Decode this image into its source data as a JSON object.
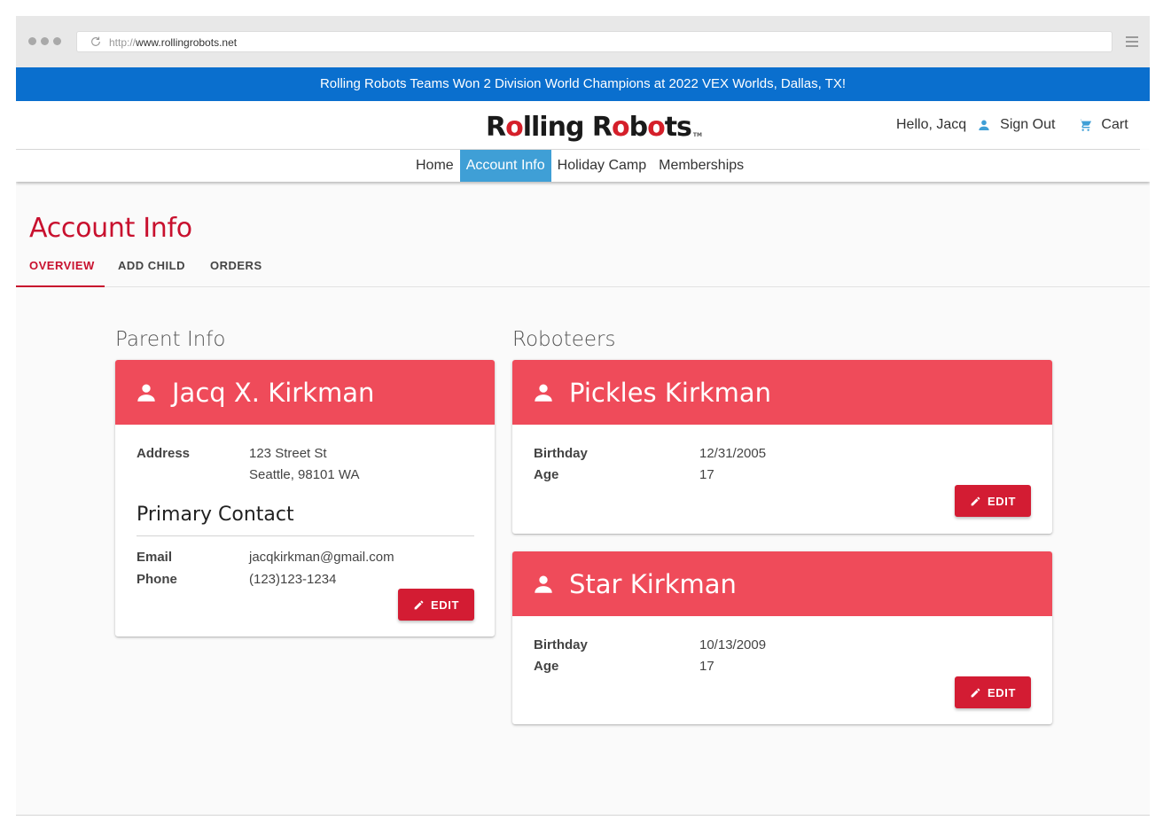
{
  "browser": {
    "url_protocol": "http://",
    "url_host": "www.rollingrobots.net"
  },
  "banner": {
    "text": "Rolling Robots Teams Won 2 Division World Champions at 2022 VEX Worlds, Dallas, TX!"
  },
  "header": {
    "logo_part1": "R",
    "logo_gear1": "o",
    "logo_part2": "lling R",
    "logo_gear2": "o",
    "logo_part3": "b",
    "logo_gear3": "o",
    "logo_part4": "ts",
    "logo_tm": "TM",
    "greeting": "Hello, Jacq",
    "sign_out": "Sign Out",
    "cart": "Cart"
  },
  "nav": {
    "items": [
      {
        "label": "Home"
      },
      {
        "label": "Account Info"
      },
      {
        "label": "Holiday Camp"
      },
      {
        "label": "Memberships"
      }
    ],
    "active": "Account Info"
  },
  "page": {
    "title": "Account Info",
    "tabs": [
      {
        "label": "OVERVIEW"
      },
      {
        "label": "ADD CHILD"
      },
      {
        "label": "ORDERS"
      }
    ]
  },
  "parent": {
    "section_title": "Parent Info",
    "name": "Jacq X. Kirkman",
    "address_label": "Address",
    "address_line1": "123 Street St",
    "address_line2": "Seattle, 98101 WA",
    "contact_title": "Primary Contact",
    "email_label": "Email",
    "email": "jacqkirkman@gmail.com",
    "phone_label": "Phone",
    "phone": "(123)123-1234",
    "edit_label": "EDIT"
  },
  "roboteers": {
    "section_title": "Roboteers",
    "children": [
      {
        "name": "Pickles Kirkman",
        "birthday_label": "Birthday",
        "birthday": "12/31/2005",
        "age_label": "Age",
        "age": "17",
        "edit_label": "EDIT"
      },
      {
        "name": "Star Kirkman",
        "birthday_label": "Birthday",
        "birthday": "10/13/2009",
        "age_label": "Age",
        "age": "17",
        "edit_label": "EDIT"
      }
    ]
  },
  "colors": {
    "banner": "#0a6fce",
    "nav_active": "#3f9fd6",
    "brand_red": "#c8102e",
    "card_header": "#ef4b5a",
    "button": "#d31c33"
  }
}
